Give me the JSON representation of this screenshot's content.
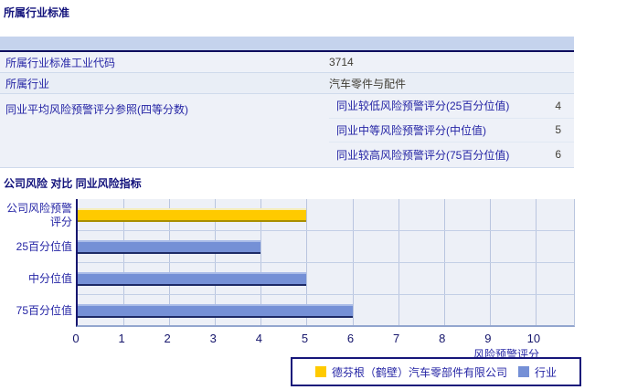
{
  "section1": {
    "title": "所属行业标准",
    "table": {
      "rows": [
        {
          "label": "所属行业标准工业代码",
          "value": "3714"
        },
        {
          "label": "所属行业",
          "value": "汽车零件与配件"
        }
      ],
      "group": {
        "label": "同业平均风险预警评分参照(四等分数)",
        "items": [
          {
            "label": "同业较低风险预警评分(25百分位值)",
            "value": "4"
          },
          {
            "label": "同业中等风险预警评分(中位值)",
            "value": "5"
          },
          {
            "label": "同业较高风险预警评分(75百分位值)",
            "value": "6"
          }
        ]
      }
    }
  },
  "section2": {
    "title": "公司风险 对比 同业风险指标"
  },
  "chart_data": {
    "type": "bar",
    "orientation": "horizontal",
    "title": "公司风险 对比 同业风险指标",
    "xlabel": "风险预警评分",
    "xlim": [
      0,
      10.9
    ],
    "xticks": [
      0,
      1,
      2,
      3,
      4,
      5,
      6,
      7,
      8,
      9,
      10
    ],
    "grid": true,
    "categories": [
      "公司风险预警\n评分",
      "25百分位值",
      "中分位值",
      "75百分位值"
    ],
    "values": [
      5,
      4,
      5,
      6
    ],
    "bars": [
      {
        "category": "公司风险预警\n评分",
        "value": 5,
        "color": "#ffca00",
        "top": "#f6edb9",
        "bottom": "#a98e00"
      },
      {
        "category": "25百分位值",
        "value": 4,
        "color": "#7590d6",
        "top": "#aabce8",
        "bottom": "#1d2a66"
      },
      {
        "category": "中分位值",
        "value": 5,
        "color": "#7590d6",
        "top": "#aabce8",
        "bottom": "#1d2a66"
      },
      {
        "category": "75百分位值",
        "value": 6,
        "color": "#7590d6",
        "top": "#aabce8",
        "bottom": "#1d2a66"
      }
    ],
    "legend": [
      {
        "label": "德芬根（鹤壁）汽车零部件有限公司",
        "color": "#ffca00"
      },
      {
        "label": "行业",
        "color": "#7590d6"
      }
    ],
    "legend_position": "bottom-right",
    "colors": {
      "plot_bg": "#edf0f7",
      "gridline": "#b9c5df",
      "axis": "#16166e",
      "company_bar": "#ffca00",
      "industry_bar": "#7590d6"
    }
  }
}
